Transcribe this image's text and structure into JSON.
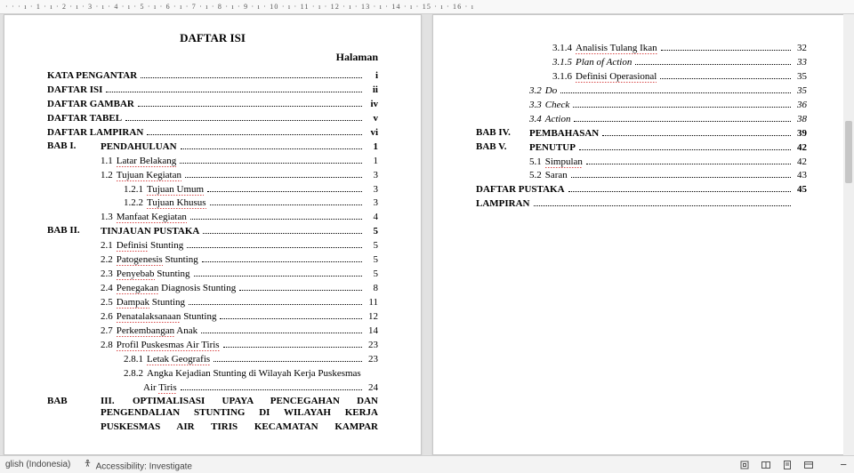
{
  "ruler": {
    "text": "· · · ı · 1 · ı · 2 · ı · 3 · ı · 4 · ı · 5 · ı · 6 · ı · 7 · ı · 8 · ı · 9 · ı · 10 · ı · 11 · ı · 12 · ı · 13 · ı · 14 · ı · 15 · ı · 16 · ı"
  },
  "doc": {
    "title": "DAFTAR ISI",
    "halaman_label": "Halaman"
  },
  "left": [
    {
      "txt": "KATA PENGANTAR",
      "pg": "i",
      "cls": "bold"
    },
    {
      "txt": "DAFTAR ISI",
      "pg": "ii",
      "cls": "bold"
    },
    {
      "txt": "DAFTAR GAMBAR",
      "pg": "iv",
      "cls": "bold"
    },
    {
      "txt": "DAFTAR TABEL",
      "pg": "v",
      "cls": "bold"
    },
    {
      "txt": "DAFTAR LAMPIRAN",
      "pg": "vi",
      "cls": "bold"
    },
    {
      "bab": "BAB I.",
      "txt": "PENDAHULUAN",
      "pg": "1",
      "cls": "bold"
    },
    {
      "num": "1.1",
      "txt": "Latar Belakang",
      "pg": "1",
      "cls": "ind1",
      "sq": true
    },
    {
      "num": "1.2",
      "txt": "Tujuan Kegiatan",
      "pg": "3",
      "cls": "ind1",
      "sq": true
    },
    {
      "num": "1.2.1",
      "txt": "Tujuan Umum",
      "pg": "3",
      "cls": "ind2",
      "sq": true
    },
    {
      "num": "1.2.2",
      "txt": "Tujuan Khusus",
      "pg": "3",
      "cls": "ind2",
      "sq": true
    },
    {
      "num": "1.3",
      "txt": "Manfaat Kegiatan",
      "pg": "4",
      "cls": "ind1",
      "sq": true
    },
    {
      "bab": "BAB II.",
      "txt": "TINJAUAN PUSTAKA",
      "pg": "5",
      "cls": "bold"
    },
    {
      "num": "2.1",
      "txt": "Definisi Stunting",
      "pg": "5",
      "cls": "ind1",
      "sq": true,
      "sqword": "Definisi"
    },
    {
      "num": "2.2",
      "txt": "Patogenesis Stunting",
      "pg": "5",
      "cls": "ind1",
      "sq": true,
      "sqword": "Patogenesis"
    },
    {
      "num": "2.3",
      "txt": "Penyebab Stunting",
      "pg": "5",
      "cls": "ind1",
      "sq": true,
      "sqword": "Penyebab"
    },
    {
      "num": "2.4",
      "txt": "Penegakan Diagnosis Stunting",
      "pg": "8",
      "cls": "ind1",
      "sq": true,
      "sqword": "Penegakan"
    },
    {
      "num": "2.5",
      "txt": "Dampak Stunting",
      "pg": "11",
      "cls": "ind1",
      "sq": true,
      "sqword": "Dampak"
    },
    {
      "num": "2.6",
      "txt": "Penatalaksanaan Stunting",
      "pg": "12",
      "cls": "ind1",
      "sq": true,
      "sqword": "Penatalaksanaan"
    },
    {
      "num": "2.7",
      "txt": "Perkembangan Anak",
      "pg": "14",
      "cls": "ind1",
      "sq": true,
      "sqword": "Perkembangan"
    },
    {
      "num": "2.8",
      "txt": "Profil Puskesmas Air Tiris",
      "pg": "23",
      "cls": "ind1",
      "sq": true
    },
    {
      "num": "2.8.1",
      "txt": "Letak Geografis",
      "pg": "23",
      "cls": "ind2",
      "sq": true
    },
    {
      "num": "2.8.2",
      "txt": "Angka Kejadian Stunting di Wilayah Kerja Puskesmas",
      "pg": "",
      "cls": "ind2 nowrap-off",
      "nodots": true
    },
    {
      "num": "",
      "txt": "Air Tiris",
      "pg": "24",
      "cls": "ind3",
      "sq": true,
      "sqword": "Tiris"
    }
  ],
  "bab3": {
    "label": "BAB",
    "roman": "III.",
    "lines": [
      "OPTIMALISASI   UPAYA   PENCEGAHAN   DAN",
      "PENGENDALIAN  STUNTING  DI  WILAYAH  KERJA",
      "PUSKESMAS  AIR  TIRIS  KECAMATAN  KAMPAR"
    ]
  },
  "right": [
    {
      "num": "3.1.4",
      "txt": "Analisis Tulang Ikan",
      "pg": "32",
      "cls": "ind2",
      "sq": true
    },
    {
      "num": "3.1.5",
      "txt": "Plan of Action",
      "pg": "33",
      "cls": "ind2 italic"
    },
    {
      "num": "3.1.6",
      "txt": "Definisi Operasional",
      "pg": "35",
      "cls": "ind2",
      "sq": true
    },
    {
      "num": "3.2",
      "txt": "Do",
      "pg": "35",
      "cls": "ind1 italic"
    },
    {
      "num": "3.3",
      "txt": "Check",
      "pg": "36",
      "cls": "ind1 italic"
    },
    {
      "num": "3.4",
      "txt": "Action",
      "pg": "38",
      "cls": "ind1 italic"
    },
    {
      "bab": "BAB IV.",
      "txt": "PEMBAHASAN",
      "pg": "39",
      "cls": "bold"
    },
    {
      "bab": "BAB V.",
      "txt": "PENUTUP",
      "pg": "42",
      "cls": "bold"
    },
    {
      "num": "5.1",
      "txt": "Simpulan",
      "pg": "42",
      "cls": "ind1",
      "sq": true
    },
    {
      "num": "5.2",
      "txt": "Saran",
      "pg": "43",
      "cls": "ind1"
    },
    {
      "txt": "DAFTAR PUSTAKA",
      "pg": "45",
      "cls": "bold"
    },
    {
      "txt": "LAMPIRAN",
      "pg": "",
      "cls": "bold"
    }
  ],
  "status": {
    "lang": "glish (Indonesia)",
    "acc": "Accessibility: Investigate"
  }
}
